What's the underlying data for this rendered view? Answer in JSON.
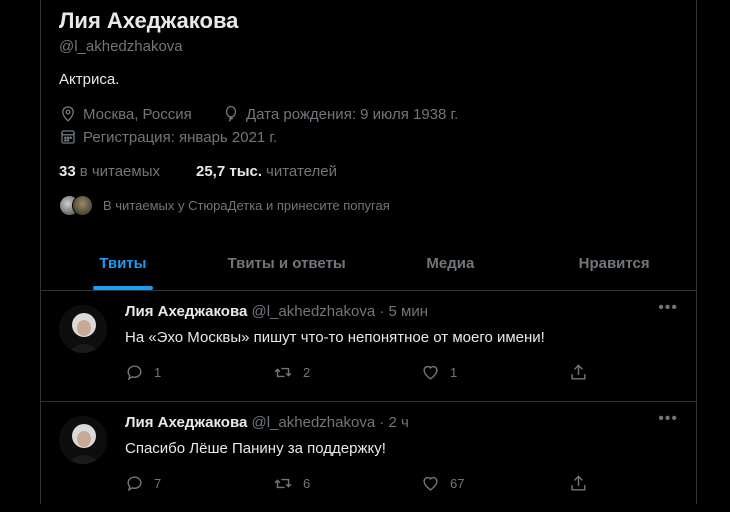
{
  "profile": {
    "name": "Лия Ахеджакова",
    "handle": "@l_akhedzhakova",
    "bio": "Актриса.",
    "location": "Москва, Россия",
    "birthday": "Дата рождения: 9 июля 1938 г.",
    "joined": "Регистрация: январь 2021 г.",
    "following_count": "33",
    "following_label": "в читаемых",
    "followers_count": "25,7 тыс.",
    "followers_label": "читателей",
    "followed_by": "В читаемых у СтюраДетка и принесите попугая"
  },
  "tabs": [
    {
      "label": "Твиты"
    },
    {
      "label": "Твиты и ответы"
    },
    {
      "label": "Медиа"
    },
    {
      "label": "Нравится"
    }
  ],
  "tweets": [
    {
      "name": "Лия Ахеджакова",
      "handle": "@l_akhedzhakova",
      "time": "· 5 мин",
      "text": "На «Эхо Москвы» пишут что-то непонятное от моего имени!",
      "replies": "1",
      "retweets": "2",
      "likes": "1"
    },
    {
      "name": "Лия Ахеджакова",
      "handle": "@l_akhedzhakova",
      "time": "· 2 ч",
      "text": "Спасибо Лёше Панину за поддержку!",
      "replies": "7",
      "retweets": "6",
      "likes": "67"
    }
  ],
  "more_label": "•••",
  "colors": {
    "accent": "#1d9bf0",
    "muted": "#71767b",
    "text": "#e7e9ea",
    "border": "#2f3336"
  },
  "icons": [
    "location-icon",
    "birthday-balloon-icon",
    "calendar-icon",
    "reply-icon",
    "retweet-icon",
    "like-icon",
    "share-icon",
    "more-icon"
  ]
}
